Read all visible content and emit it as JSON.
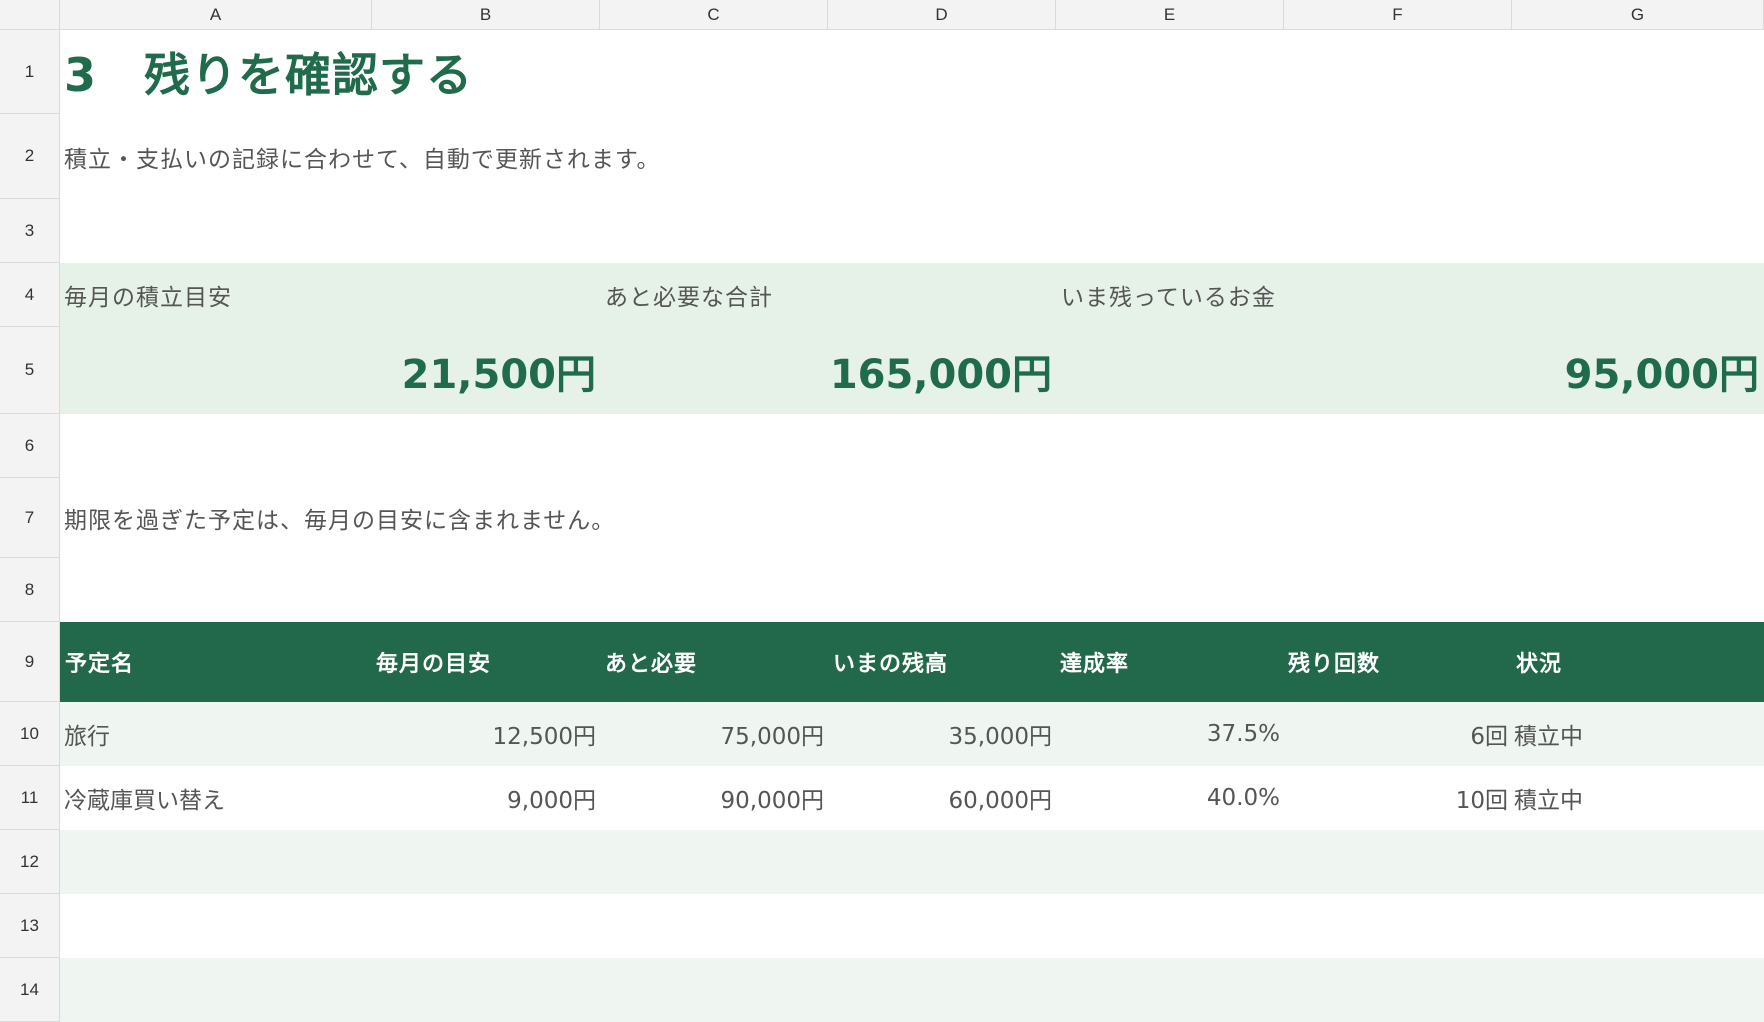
{
  "columns": [
    "A",
    "B",
    "C",
    "D",
    "E",
    "F",
    "G"
  ],
  "rows": [
    "1",
    "2",
    "3",
    "4",
    "5",
    "6",
    "7",
    "8",
    "9",
    "10",
    "11",
    "12",
    "13",
    "14"
  ],
  "title": "3　残りを確認する",
  "subtitle": "積立・支払いの記録に合わせて、自動で更新されます。",
  "summary": {
    "monthly_label": "毎月の積立目安",
    "monthly_value": "21,500円",
    "needed_label": "あと必要な合計",
    "needed_value": "165,000円",
    "remaining_label": "いま残っているお金",
    "remaining_value": "95,000円"
  },
  "note": "期限を過ぎた予定は、毎月の目安に含まれません。",
  "table": {
    "headers": [
      "予定名",
      "毎月の目安",
      "あと必要",
      "いまの残高",
      "達成率",
      "残り回数",
      "状況"
    ],
    "rows": [
      [
        "旅行",
        "12,500円",
        "75,000円",
        "35,000円",
        "37.5%",
        "6回",
        "積立中"
      ],
      [
        "冷蔵庫買い替え",
        "9,000円",
        "90,000円",
        "60,000円",
        "40.0%",
        "10回",
        "積立中"
      ]
    ]
  },
  "colors": {
    "accent": "#1f6b4b",
    "header_bg": "#22684a",
    "summary_bg": "#e6f1e8",
    "stripe_bg": "#eff6f1"
  }
}
